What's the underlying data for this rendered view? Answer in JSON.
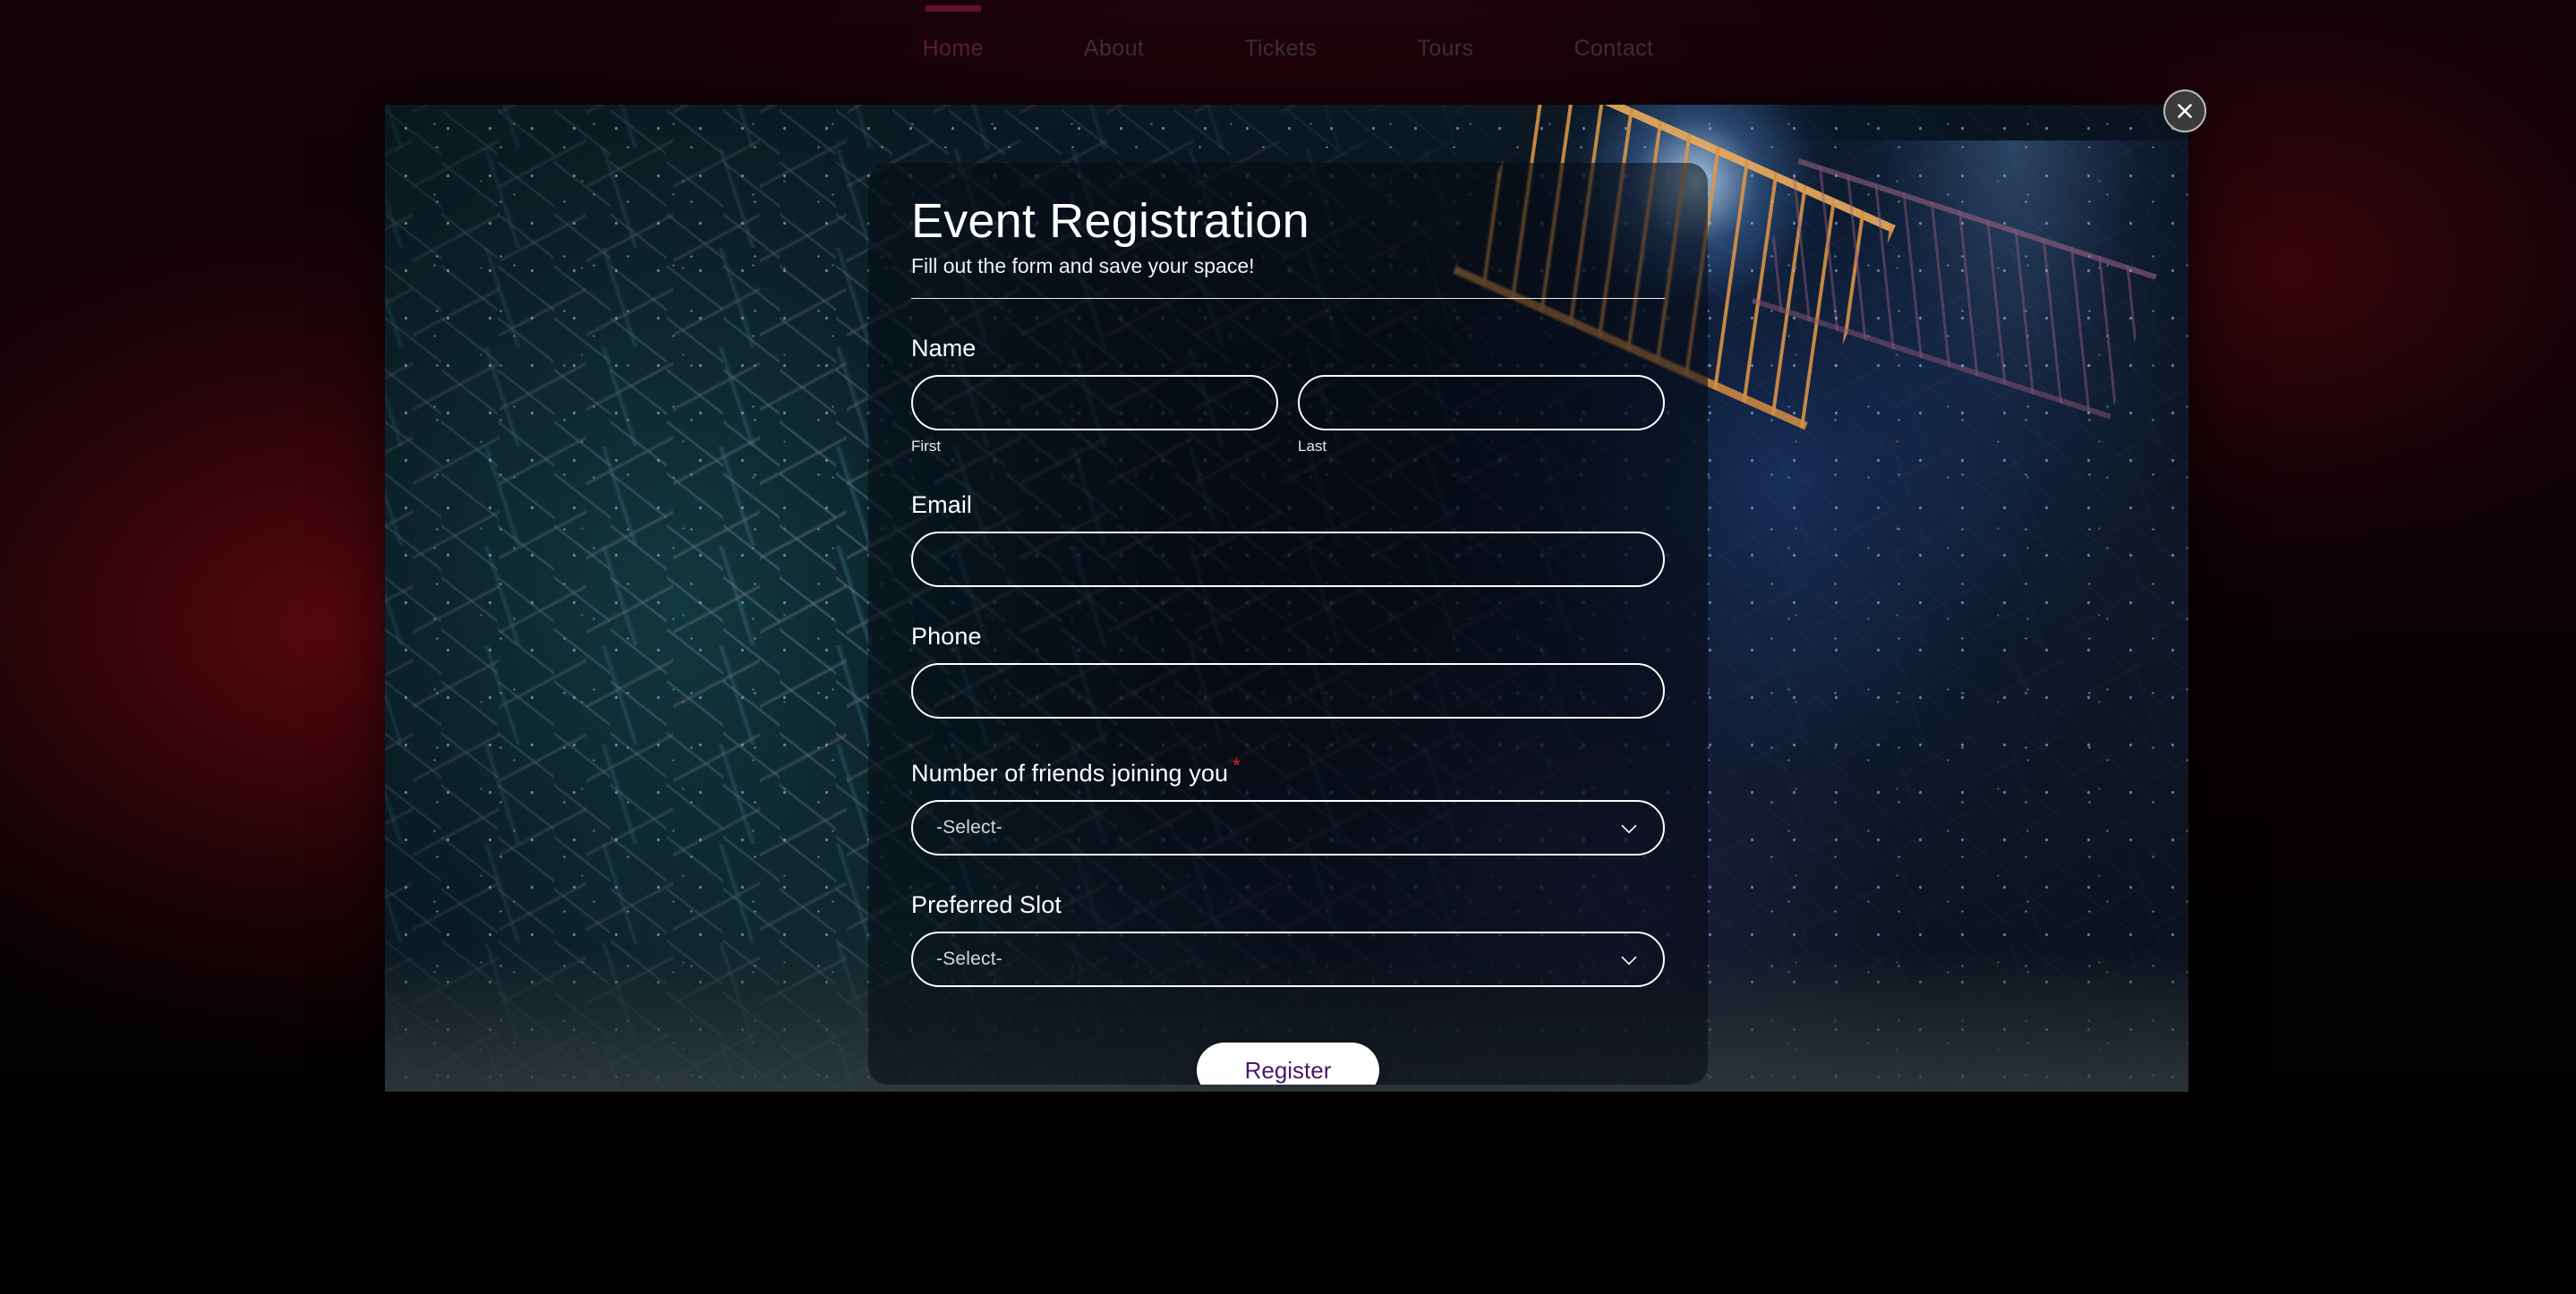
{
  "nav": {
    "items": [
      {
        "label": "Home",
        "active": true
      },
      {
        "label": "About",
        "active": false
      },
      {
        "label": "Tickets",
        "active": false
      },
      {
        "label": "Tours",
        "active": false
      },
      {
        "label": "Contact",
        "active": false
      }
    ]
  },
  "modal": {
    "close_icon": "close-x-icon",
    "form": {
      "title": "Event Registration",
      "subtitle": "Fill out the form and save your space!",
      "name": {
        "label": "Name",
        "first": {
          "value": "",
          "placeholder": "",
          "sub_label": "First"
        },
        "last": {
          "value": "",
          "placeholder": "",
          "sub_label": "Last"
        }
      },
      "email": {
        "label": "Email",
        "value": "",
        "placeholder": ""
      },
      "phone": {
        "label": "Phone",
        "value": "",
        "placeholder": ""
      },
      "friends": {
        "label": "Number of friends joining you",
        "required_marker": "*",
        "selected": "-Select-",
        "chevron_icon": "chevron-down-icon"
      },
      "slot": {
        "label": "Preferred Slot",
        "selected": "-Select-",
        "chevron_icon": "chevron-down-icon"
      },
      "submit_label": "Register"
    }
  },
  "colors": {
    "accent_nav_active": "#61132a",
    "required_star": "#ec1c24",
    "button_text": "#4b176b",
    "button_bg": "#ffffff",
    "field_border": "#ffffff"
  }
}
